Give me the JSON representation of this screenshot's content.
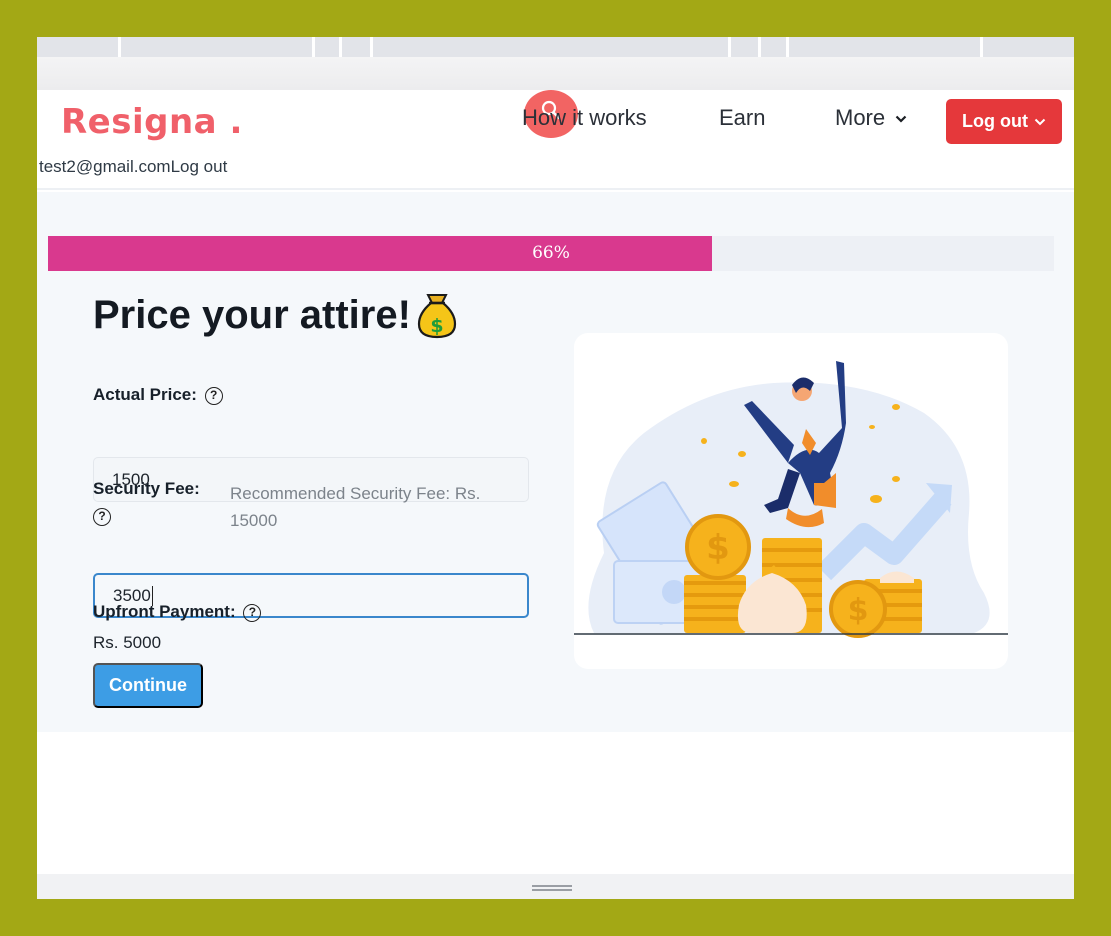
{
  "app": {
    "logo": "Resigna .",
    "user_email": "test2@gmail.com",
    "user_logout": "Log out"
  },
  "nav": {
    "how_it_works": "How it works",
    "earn": "Earn",
    "more": "More",
    "logout_button": "Log out"
  },
  "progress": {
    "percent": 66,
    "label": "66%"
  },
  "form": {
    "heading": "Price your attire!",
    "heading_emoji": "💰",
    "actual_price_label": "Actual Price:",
    "actual_price_value": "1500",
    "security_fee_label": "Security Fee:",
    "recommended_fee_text": "Recommended Security Fee: Rs. 15000",
    "security_fee_value": "3500",
    "upfront_label": "Upfront Payment:",
    "upfront_value": "Rs. 5000",
    "help_glyph": "?",
    "continue_button": "Continue"
  },
  "colors": {
    "brand": "#f0606a",
    "progress": "#d9398e",
    "logout": "#e5383b",
    "continue": "#3d9de5",
    "window_frame": "#a3a815"
  },
  "icons": {
    "search": "search-icon",
    "chevron": "chevron-down-icon",
    "help": "question-circle-icon"
  }
}
